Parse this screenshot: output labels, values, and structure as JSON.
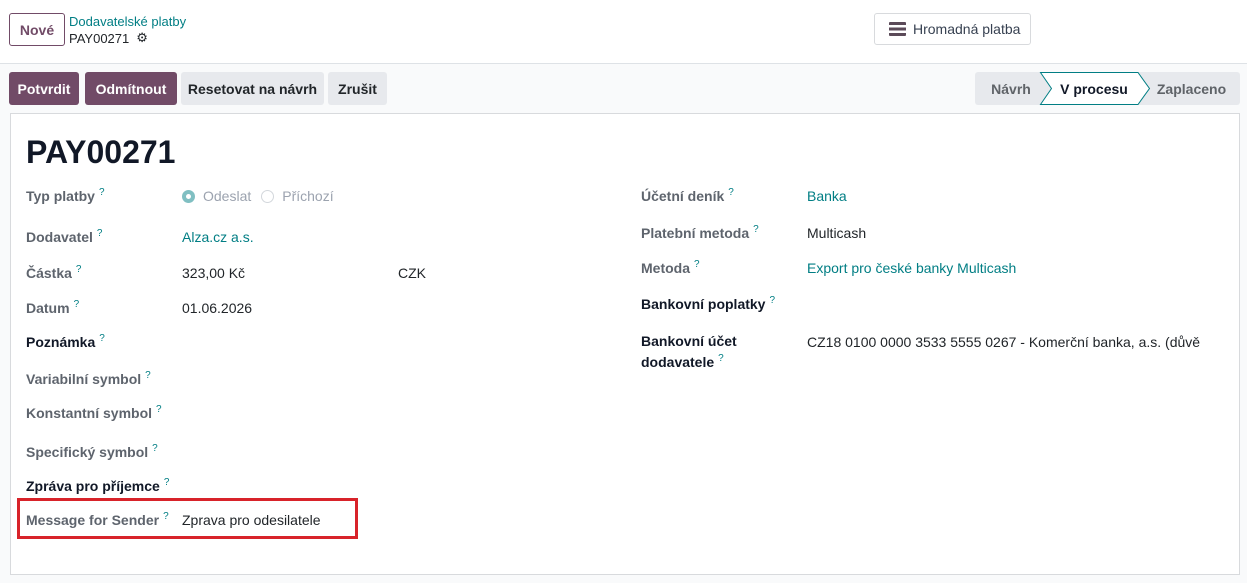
{
  "colors": {
    "primary": "#714B67",
    "link": "#017e84",
    "highlight": "#d8232a"
  },
  "icons": {
    "settings": "gear-icon",
    "batch_payment": "hamburger-menu-icon",
    "help": "help-tooltip-icon"
  },
  "control_panel": {
    "new_button": "Nové",
    "breadcrumb_parent": "Dodavatelské platby",
    "record_name": "PAY00271",
    "batch_payment_button": "Hromadná platba"
  },
  "header": {
    "buttons": [
      "Potvrdit",
      "Odmítnout",
      "Resetovat na návrh",
      "Zrušit"
    ],
    "statusbar": [
      {
        "label": "Návrh",
        "active": false
      },
      {
        "label": "V procesu",
        "active": true
      },
      {
        "label": "Zaplaceno",
        "active": false
      }
    ]
  },
  "help_marker": "?",
  "form": {
    "title": "PAY00271",
    "payment_type": {
      "label": "Typ platby",
      "options": [
        {
          "label": "Odeslat",
          "selected": true
        },
        {
          "label": "Příchozí",
          "selected": false
        }
      ]
    },
    "partner": {
      "label": "Dodavatel",
      "value": "Alza.cz a.s."
    },
    "amount": {
      "label": "Částka",
      "value": "323,00 Kč",
      "currency": "CZK"
    },
    "date": {
      "label": "Datum",
      "value": "01.06.2026"
    },
    "note": {
      "label": "Poznámka"
    },
    "variable_symbol": {
      "label": "Variabilní symbol"
    },
    "constant_symbol": {
      "label": "Konstantní symbol"
    },
    "specific_symbol": {
      "label": "Specifický symbol"
    },
    "message_for_recipient": {
      "label": "Zpráva pro příjemce"
    },
    "message_for_sender": {
      "label": "Message for Sender",
      "value": "Zprava pro odesilatele"
    },
    "journal": {
      "label": "Účetní deník",
      "value": "Banka"
    },
    "payment_method": {
      "label": "Platební metoda",
      "value": "Multicash"
    },
    "method": {
      "label": "Metoda",
      "value": "Export pro české banky Multicash"
    },
    "bank_charges": {
      "label": "Bankovní poplatky"
    },
    "partner_bank": {
      "label": "Bankovní účet dodavatele",
      "value": "CZ18 0100 0000 3533 5555 0267 - Komerční banka, a.s. (důvě"
    }
  }
}
